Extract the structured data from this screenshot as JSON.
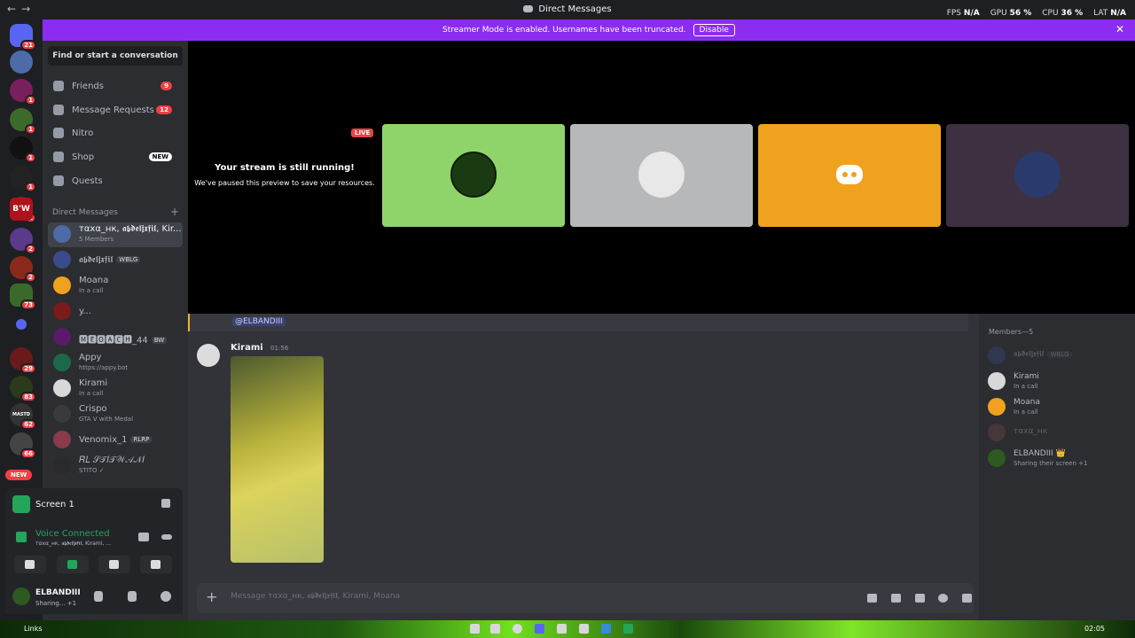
{
  "titlebar": {
    "title": "Direct Messages",
    "back": "←",
    "forward": "→",
    "stats": [
      {
        "label": "FPS",
        "value": "N/A"
      },
      {
        "label": "GPU",
        "value": "56 %"
      },
      {
        "label": "CPU",
        "value": "36 %"
      },
      {
        "label": "LAT",
        "value": "N/A"
      }
    ]
  },
  "banner": {
    "text": "Streamer Mode is enabled. Usernames have been truncated.",
    "button": "Disable",
    "close": "✕"
  },
  "guilds": {
    "badges": [
      "21",
      "1",
      "1",
      "1",
      "1",
      "2",
      "2",
      "2",
      "73",
      "29",
      "83",
      "62",
      "66"
    ],
    "labels": {
      "bw": "B'W",
      "rl": "RL",
      "mastd": "MASTD"
    },
    "new": "NEW"
  },
  "sidebar": {
    "find": "Find or start a conversation",
    "nav": [
      {
        "label": "Friends",
        "count": "9"
      },
      {
        "label": "Message Requests",
        "count": "12"
      },
      {
        "label": "Nitro"
      },
      {
        "label": "Shop",
        "tag": "NEW"
      },
      {
        "label": "Quests"
      }
    ],
    "dm_header": "Direct Messages",
    "dm_add": "+",
    "dms": [
      {
        "name": "тαxα_нк, 𝖆𝖇𝖉𝖊𝖑𝖏𝖝𝖋𝖎𝖑, Kir...",
        "sub": "5 Members"
      },
      {
        "name": "𝖆𝖇𝖉𝖊𝖑𝖏𝖝𝖋𝖎𝖑",
        "tag": "WBLG"
      },
      {
        "name": "Moana",
        "sub": "In a call"
      },
      {
        "name": "y..."
      },
      {
        "name": "🅼🅴🅾🅰🅲🅷_44",
        "tag": "BW"
      },
      {
        "name": "Appy",
        "sub": "https://appy.bot"
      },
      {
        "name": "Kirami",
        "sub": "In a call"
      },
      {
        "name": "Crispo",
        "sub": "GTA V with Medal"
      },
      {
        "name": "Venomix_1",
        "tag": "RLRP"
      },
      {
        "name": "𝑅𝐿 𝒮𝒯𝐼𝒯𝒲𝒜𝒩𝐼",
        "sub": "STITO ✓"
      }
    ]
  },
  "rtc": {
    "screen_label": "Screen 1",
    "status": "Voice Connected",
    "channel": "тαxα_нк, 𝖆𝖇𝖉𝖊𝖑𝖏𝖝𝖋𝖎𝖑, Kirami, ..."
  },
  "user": {
    "name": "ELBANDIII",
    "status": "Sharing... +1"
  },
  "stage": {
    "live": "LIVE",
    "title": "Your stream is still running!",
    "subtitle": "We've paused this preview to save your resources.",
    "tiles": [
      {
        "bg": "#8fd46a",
        "avatar_text": "ELBANDIII"
      },
      {
        "bg": "#b7b8ba"
      },
      {
        "bg": "#f0a21e",
        "avatar_text": "Discord"
      },
      {
        "bg": "#3d3041"
      }
    ]
  },
  "mention": "@ELBANDIII",
  "message": {
    "author": "Kirami",
    "time": "01:56"
  },
  "composer": {
    "plus": "+",
    "placeholder": "Message тαxα_нк, 𝖆𝖇𝖉𝖊𝖑𝖏𝖝𝖋𝖎𝖑, Kirami, Moana"
  },
  "members": {
    "header": "Members—5",
    "list": [
      {
        "name": "𝖆𝖇𝖉𝖊𝖑𝖏𝖝𝖋𝖎𝖑",
        "tag": "WBLG",
        "dim": true
      },
      {
        "name": "Kirami",
        "sub": "In a call"
      },
      {
        "name": "Moana",
        "sub": "In a call"
      },
      {
        "name": "тαxα_нк",
        "dim": true
      },
      {
        "name": "ELBANDIII 👑",
        "sub": "Sharing their screen +1"
      }
    ]
  },
  "taskbar": {
    "links": "Links",
    "time": "02:05"
  },
  "colors": {
    "accent": "#8c2cf0",
    "online": "#23a55a",
    "badge": "#f23f43",
    "mention": "#f0b232"
  }
}
